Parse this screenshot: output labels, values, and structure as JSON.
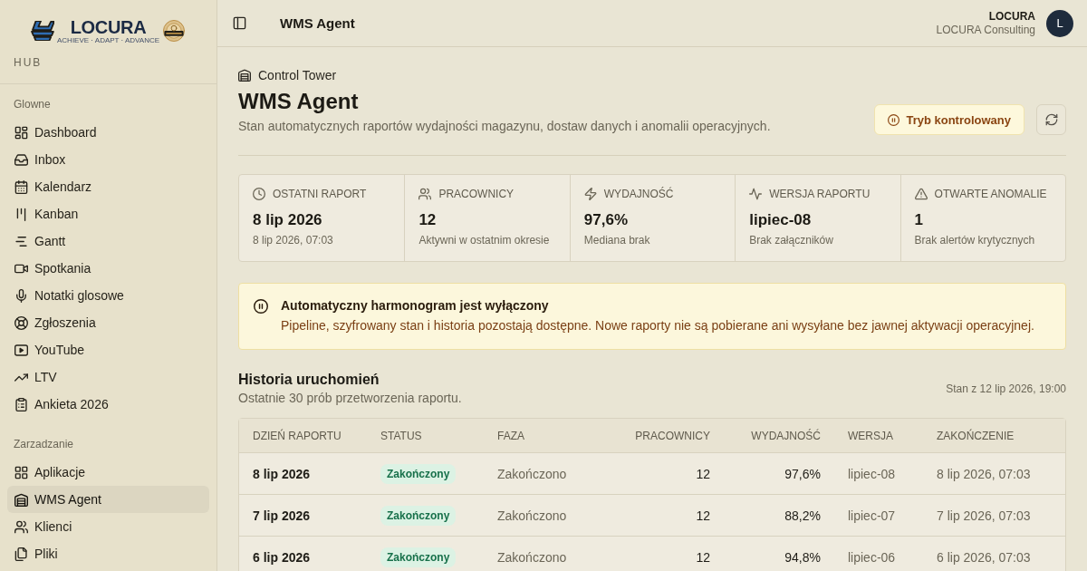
{
  "sidebar": {
    "logo": {
      "wordmark": "LOCURA",
      "tagline": "ACHIEVE · ADAPT · ADVANCE"
    },
    "hub_label": "HUB",
    "sections": [
      {
        "title": "Glowne",
        "items": [
          {
            "label": "Dashboard",
            "selected": false
          },
          {
            "label": "Inbox",
            "selected": false
          },
          {
            "label": "Kalendarz",
            "selected": false
          },
          {
            "label": "Kanban",
            "selected": false
          },
          {
            "label": "Gantt",
            "selected": false
          },
          {
            "label": "Spotkania",
            "selected": false
          },
          {
            "label": "Notatki glosowe",
            "selected": false
          },
          {
            "label": "Zgłoszenia",
            "selected": false
          },
          {
            "label": "YouTube",
            "selected": false
          },
          {
            "label": "LTV",
            "selected": false
          },
          {
            "label": "Ankieta 2026",
            "selected": false
          }
        ]
      },
      {
        "title": "Zarzadzanie",
        "items": [
          {
            "label": "Aplikacje",
            "selected": false
          },
          {
            "label": "WMS Agent",
            "selected": true
          },
          {
            "label": "Klienci",
            "selected": false
          },
          {
            "label": "Pliki",
            "selected": false
          }
        ]
      }
    ]
  },
  "top_bar": {
    "title": "WMS Agent",
    "user": {
      "name": "LOCURA",
      "organization": "LOCURA Consulting",
      "avatar_initial": "L"
    }
  },
  "page_header": {
    "breadcrumb": "Control Tower",
    "title": "WMS Agent",
    "description": "Stan automatycznych raportów wydajności magazynu, dostaw danych i anomalii operacyjnych.",
    "mode_button": "Tryb kontrolowany"
  },
  "stats": [
    {
      "label": "OSTATNI RAPORT",
      "value": "8 lip 2026",
      "note": "8 lip 2026, 07:03"
    },
    {
      "label": "PRACOWNICY",
      "value": "12",
      "note": "Aktywni w ostatnim okresie"
    },
    {
      "label": "WYDAJNOŚĆ",
      "value": "97,6%",
      "note": "Mediana brak"
    },
    {
      "label": "WERSJA RAPORTU",
      "value": "lipiec-08",
      "note": "Brak załączników"
    },
    {
      "label": "OTWARTE ANOMALIE",
      "value": "1",
      "note": "Brak alertów krytycznych"
    }
  ],
  "notice": {
    "title": "Automatyczny harmonogram jest wyłączony",
    "text": "Pipeline, szyfrowany stan i historia pozostają dostępne. Nowe raporty nie są pobierane ani wysyłane bez jawnej aktywacji operacyjnej."
  },
  "history": {
    "title": "Historia uruchomień",
    "subtitle": "Ostatnie 30 prób przetworzenia raportu.",
    "as_of": "Stan z 12 lip 2026, 19:00",
    "table": {
      "columns": [
        "DZIEŃ RAPORTU",
        "STATUS",
        "FAZA",
        "PRACOWNICY",
        "WYDAJNOŚĆ",
        "WERSJA",
        "ZAKOŃCZENIE"
      ],
      "rows": [
        {
          "day": "8 lip 2026",
          "status": "Zakończony",
          "phase": "Zakończono",
          "workers": "12",
          "efficiency": "97,6%",
          "version": "lipiec-08",
          "finished": "8 lip 2026, 07:03"
        },
        {
          "day": "7 lip 2026",
          "status": "Zakończony",
          "phase": "Zakończono",
          "workers": "12",
          "efficiency": "88,2%",
          "version": "lipiec-07",
          "finished": "7 lip 2026, 07:03"
        },
        {
          "day": "6 lip 2026",
          "status": "Zakończony",
          "phase": "Zakończono",
          "workers": "12",
          "efficiency": "94,8%",
          "version": "lipiec-06",
          "finished": "6 lip 2026, 07:03"
        }
      ]
    }
  }
}
